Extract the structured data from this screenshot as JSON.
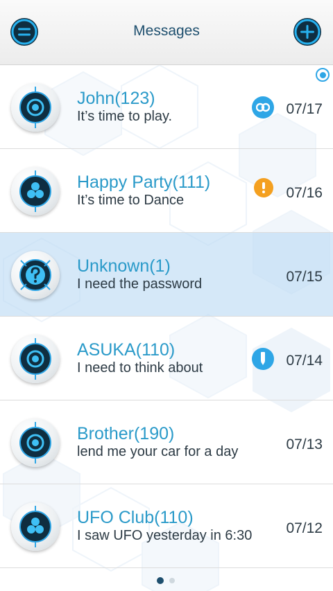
{
  "header": {
    "title": "Messages",
    "left_icon": "menu-icon",
    "right_icon": "plus-icon"
  },
  "colors": {
    "accent": "#2a9ac9",
    "dark": "#0f2e40",
    "link_badge": "#2ea6e6",
    "alert_badge": "#f4a020",
    "selected_row": "#d4e7f6"
  },
  "conversations": [
    {
      "name": "John(123)",
      "message": "It’s time to play.",
      "date": "07/17",
      "avatar": "robot-avatar",
      "badge": "link-icon"
    },
    {
      "name": "Happy Party(111)",
      "message": "It’s time to Dance",
      "date": "07/16",
      "avatar": "group-avatar",
      "badge": "exclamation-icon"
    },
    {
      "name": "Unknown(1)",
      "message": "I need the password",
      "date": "07/15",
      "avatar": "question-avatar",
      "badge": "",
      "selected": true
    },
    {
      "name": "ASUKA(110)",
      "message": "I need to think about",
      "date": "07/14",
      "avatar": "robot-avatar",
      "badge": "pencil-icon"
    },
    {
      "name": "Brother(190)",
      "message": "lend me your car for a day",
      "date": "07/13",
      "avatar": "robot-avatar",
      "badge": ""
    },
    {
      "name": "UFO Club(110)",
      "message": "I saw UFO yesterday in 6:30",
      "date": "07/12",
      "avatar": "group-avatar",
      "badge": ""
    }
  ],
  "pager": {
    "pages": 2,
    "current": 1
  }
}
